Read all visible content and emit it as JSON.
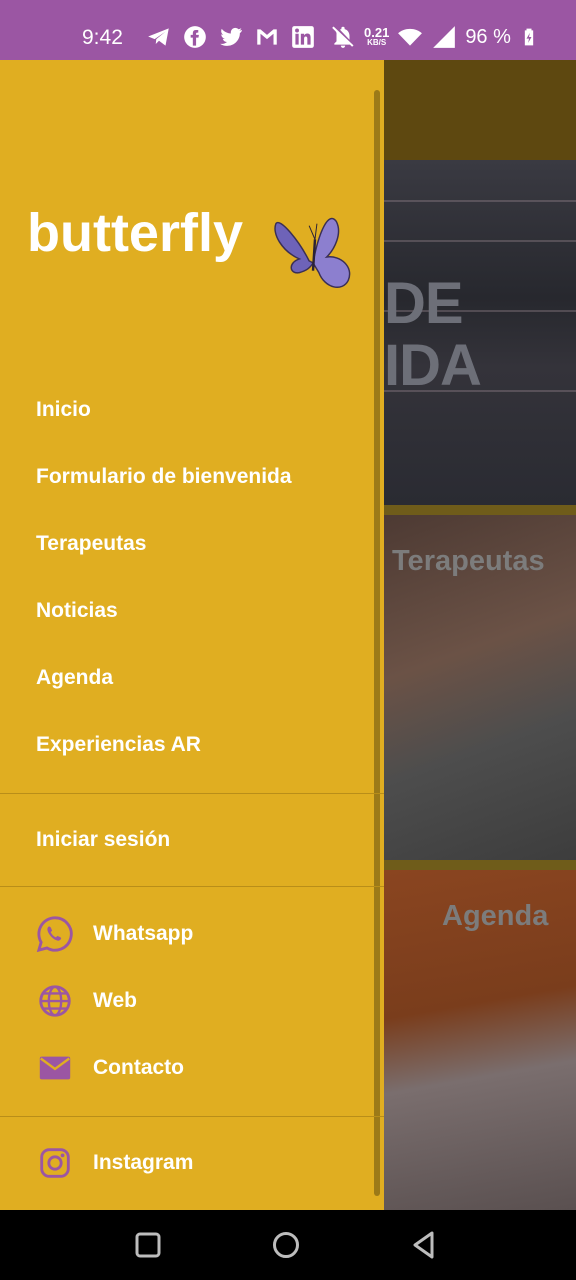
{
  "status_bar": {
    "time": "9:42",
    "net_speed_value": "0.21",
    "net_speed_unit": "KB/S",
    "battery": "96 %",
    "icons": [
      "telegram-icon",
      "facebook-icon",
      "twitter-icon",
      "gmail-icon",
      "linkedin-icon",
      "mute-icon",
      "wifi-icon",
      "signal-icon",
      "battery-charging-icon"
    ]
  },
  "background": {
    "banner_line1": "DE",
    "banner_line2": "IDA",
    "card_terapeutas": "Terapeutas",
    "card_agenda": "Agenda"
  },
  "drawer": {
    "brand": "butterfly",
    "menu": [
      {
        "label": "Inicio"
      },
      {
        "label": "Formulario de bienvenida"
      },
      {
        "label": "Terapeutas"
      },
      {
        "label": "Noticias"
      },
      {
        "label": "Agenda"
      },
      {
        "label": "Experiencias AR"
      }
    ],
    "login": "Iniciar sesión",
    "contact": [
      {
        "label": "Whatsapp",
        "icon": "whatsapp-icon"
      },
      {
        "label": "Web",
        "icon": "globe-icon"
      },
      {
        "label": "Contacto",
        "icon": "mail-icon"
      }
    ],
    "instagram": {
      "label": "Instagram",
      "icon": "instagram-icon"
    }
  },
  "colors": {
    "status_bar": "#9b56a3",
    "drawer_bg": "#e0ae21",
    "icon_purple": "#9b56a3",
    "text": "#ffffff"
  },
  "nav_bar": {
    "buttons": [
      "recents-button",
      "home-button",
      "back-button"
    ]
  }
}
